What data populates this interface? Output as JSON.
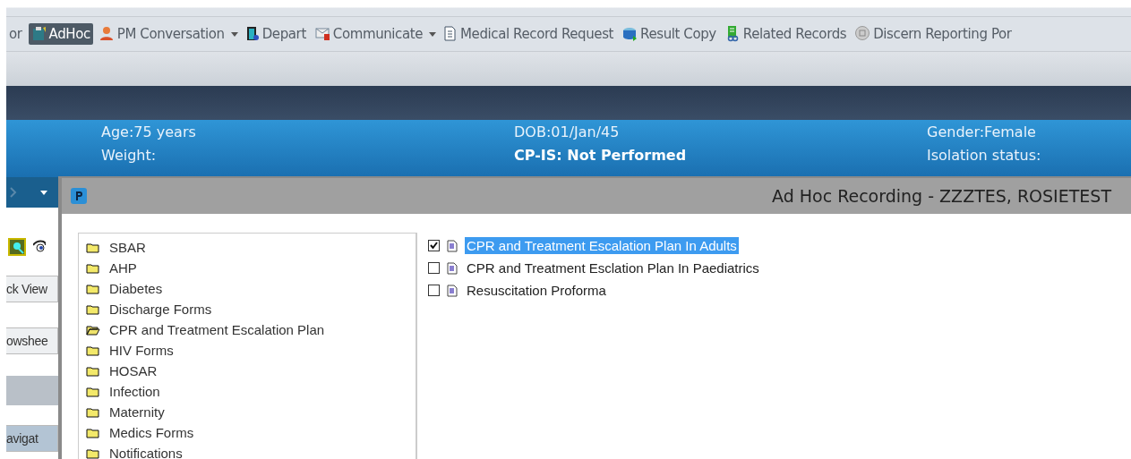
{
  "toolbar": {
    "items": [
      {
        "label": "or",
        "selected": false,
        "dropdown": false
      },
      {
        "label": "AdHoc",
        "selected": true,
        "dropdown": false
      },
      {
        "label": "PM Conversation",
        "selected": false,
        "dropdown": true
      },
      {
        "label": "Depart",
        "selected": false,
        "dropdown": false
      },
      {
        "label": "Communicate",
        "selected": false,
        "dropdown": true
      },
      {
        "label": "Medical Record Request",
        "selected": false,
        "dropdown": false
      },
      {
        "label": "Result Copy",
        "selected": false,
        "dropdown": false
      },
      {
        "label": "Related Records",
        "selected": false,
        "dropdown": false
      },
      {
        "label": "Discern Reporting Por",
        "selected": false,
        "dropdown": false
      }
    ]
  },
  "banner": {
    "columns": [
      [
        {
          "text": "Age:75 years",
          "bold": false
        },
        {
          "text": "Weight:",
          "bold": false
        }
      ],
      [
        {
          "text": "DOB:01/Jan/45",
          "bold": false
        },
        {
          "text": "CP-IS: Not Performed",
          "bold": true
        }
      ],
      [
        {
          "text": "Gender:Female",
          "bold": false
        },
        {
          "text": "Isolation status:",
          "bold": false
        }
      ]
    ]
  },
  "side_buttons": [
    "ck View",
    "owshee",
    "avigat"
  ],
  "dialog": {
    "title": "Ad Hoc Recording - ZZZTES, ROSIETEST",
    "folders": [
      {
        "label": "SBAR",
        "expanded": false
      },
      {
        "label": "AHP",
        "expanded": false
      },
      {
        "label": "Diabetes",
        "expanded": false
      },
      {
        "label": "Discharge Forms",
        "expanded": false
      },
      {
        "label": "CPR and Treatment Escalation Plan",
        "expanded": true
      },
      {
        "label": "HIV Forms",
        "expanded": false
      },
      {
        "label": "HOSAR",
        "expanded": false
      },
      {
        "label": "Infection",
        "expanded": false
      },
      {
        "label": "Maternity",
        "expanded": false
      },
      {
        "label": "Medics Forms",
        "expanded": false
      },
      {
        "label": "Notifications",
        "expanded": false
      }
    ],
    "forms": [
      {
        "label": "CPR and Treatment Escalation Plan In Adults",
        "checked": true,
        "selected": true
      },
      {
        "label": "CPR and Treatment Esclation Plan In Paediatrics",
        "checked": false,
        "selected": false
      },
      {
        "label": "Resuscitation Proforma",
        "checked": false,
        "selected": false
      }
    ]
  }
}
